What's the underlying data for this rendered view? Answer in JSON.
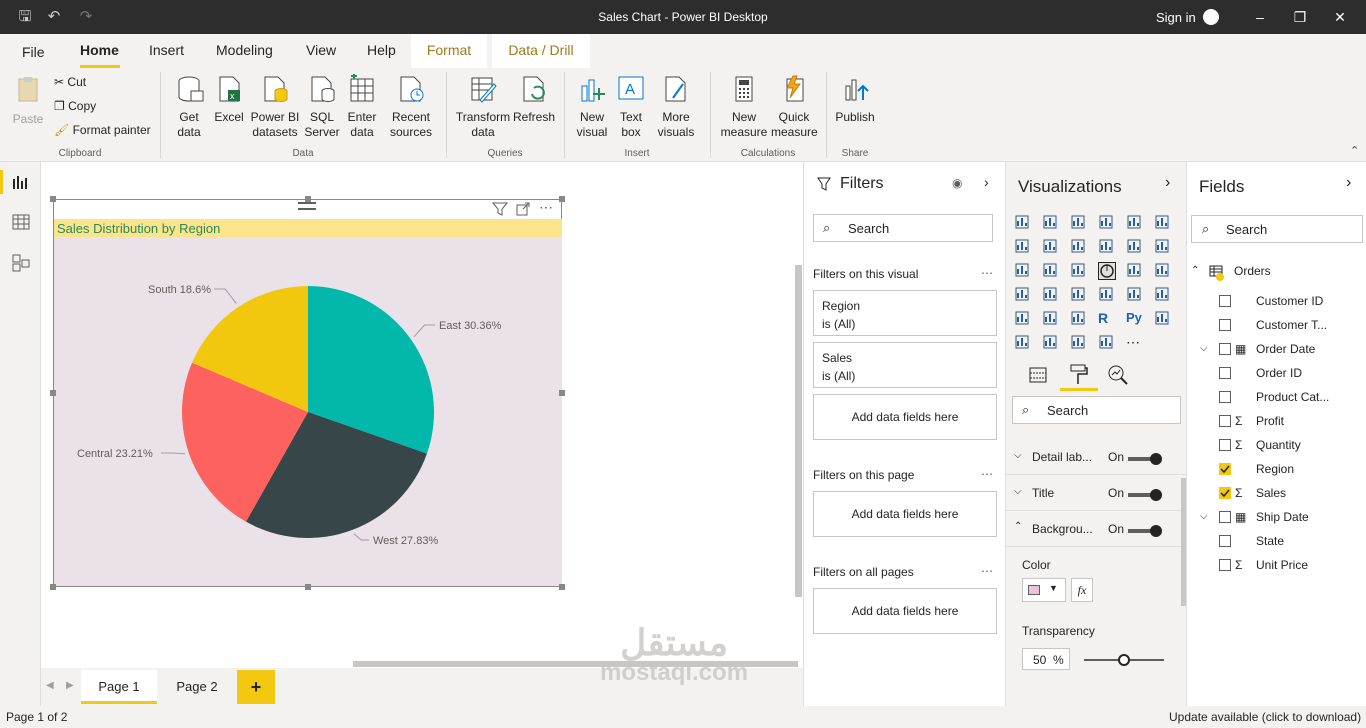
{
  "window": {
    "title": "Sales Chart - Power BI Desktop",
    "sign_in": "Sign in"
  },
  "tabs": [
    "File",
    "Home",
    "Insert",
    "Modeling",
    "View",
    "Help"
  ],
  "context_tabs": [
    "Format",
    "Data / Drill"
  ],
  "ribbon": {
    "clipboard": {
      "paste": "Paste",
      "cut": "Cut",
      "copy": "Copy",
      "format_painter": "Format painter",
      "group": "Clipboard"
    },
    "data": {
      "get_data": "Get\ndata",
      "excel": "Excel",
      "pbi_datasets": "Power BI\ndatasets",
      "sql": "SQL\nServer",
      "enter": "Enter\ndata",
      "recent": "Recent\nsources",
      "group": "Data"
    },
    "queries": {
      "transform": "Transform\ndata",
      "refresh": "Refresh",
      "group": "Queries"
    },
    "insert": {
      "new_visual": "New\nvisual",
      "text_box": "Text\nbox",
      "more": "More\nvisuals",
      "group": "Insert"
    },
    "calc": {
      "new_measure": "New\nmeasure",
      "quick_measure": "Quick\nmeasure",
      "group": "Calculations"
    },
    "share": {
      "publish": "Publish",
      "group": "Share"
    }
  },
  "visual": {
    "title": "Sales Distribution by Region"
  },
  "chart_data": {
    "type": "pie",
    "title": "Sales Distribution by Region",
    "slices": [
      {
        "label": "East",
        "value": 30.36,
        "color": "#01b8aa"
      },
      {
        "label": "West",
        "value": 27.83,
        "color": "#374649"
      },
      {
        "label": "Central",
        "value": 23.21,
        "color": "#fd625e"
      },
      {
        "label": "South",
        "value": 18.6,
        "color": "#f2c80f"
      }
    ],
    "data_labels": [
      "East 30.36%",
      "West 27.83%",
      "Central 23.21%",
      "South 18.6%"
    ]
  },
  "pages": {
    "tabs": [
      "Page 1",
      "Page 2"
    ],
    "add": "+",
    "status": "Page 1 of 2",
    "update": "Update available (click to download)"
  },
  "filters": {
    "title": "Filters",
    "search": "Search",
    "on_visual": "Filters on this visual",
    "cards": [
      {
        "name": "Region",
        "state": "is (All)"
      },
      {
        "name": "Sales",
        "state": "is (All)"
      }
    ],
    "add_fields": "Add data fields here",
    "on_page": "Filters on this page",
    "on_all": "Filters on all pages"
  },
  "visualizations": {
    "title": "Visualizations",
    "search": "Search",
    "settings": [
      {
        "label": "Detail lab...",
        "value": "On"
      },
      {
        "label": "Title",
        "value": "On"
      },
      {
        "label": "Backgrou...",
        "value": "On"
      }
    ],
    "color_label": "Color",
    "fx": "fx",
    "transparency_label": "Transparency",
    "transparency_value": "50",
    "transparency_unit": "%",
    "transparency_level": 0.5,
    "swatch_color": "#e8c3dd"
  },
  "fields": {
    "title": "Fields",
    "search": "Search",
    "table": "Orders",
    "items": [
      {
        "name": "Customer ID",
        "checked": false,
        "icon": ""
      },
      {
        "name": "Customer T...",
        "checked": false,
        "icon": ""
      },
      {
        "name": "Order Date",
        "checked": false,
        "icon": "calendar"
      },
      {
        "name": "Order ID",
        "checked": false,
        "icon": ""
      },
      {
        "name": "Product Cat...",
        "checked": false,
        "icon": ""
      },
      {
        "name": "Profit",
        "checked": false,
        "icon": "sigma"
      },
      {
        "name": "Quantity",
        "checked": false,
        "icon": "sigma"
      },
      {
        "name": "Region",
        "checked": true,
        "icon": ""
      },
      {
        "name": "Sales",
        "checked": true,
        "icon": "sigma"
      },
      {
        "name": "Ship Date",
        "checked": false,
        "icon": "calendar"
      },
      {
        "name": "State",
        "checked": false,
        "icon": ""
      },
      {
        "name": "Unit Price",
        "checked": false,
        "icon": "sigma"
      }
    ]
  },
  "watermark": {
    "arabic": "مستقل",
    "latin": "mostaql.com"
  }
}
